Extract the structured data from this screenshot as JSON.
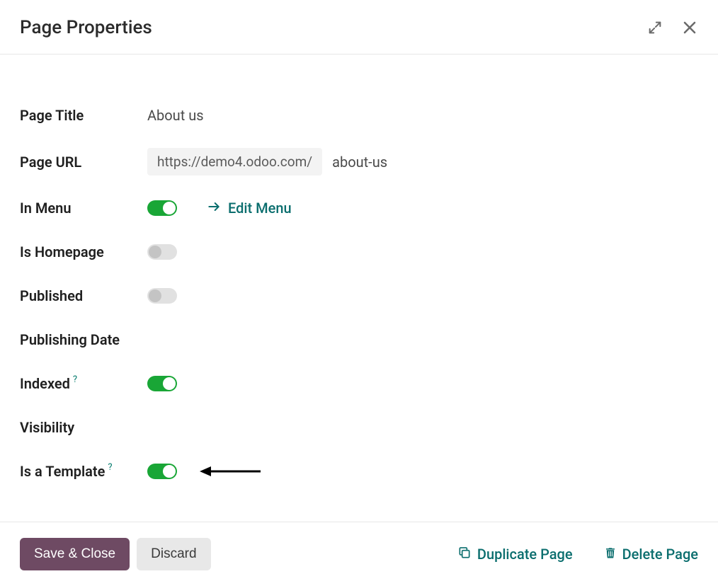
{
  "header": {
    "title": "Page Properties"
  },
  "form": {
    "page_title": {
      "label": "Page Title",
      "value": "About us"
    },
    "page_url": {
      "label": "Page URL",
      "prefix": "https://demo4.odoo.com/",
      "slug": "about-us"
    },
    "in_menu": {
      "label": "In Menu",
      "on": true,
      "edit_label": "Edit Menu"
    },
    "is_homepage": {
      "label": "Is Homepage",
      "on": false
    },
    "published": {
      "label": "Published",
      "on": false
    },
    "publishing_date": {
      "label": "Publishing Date",
      "value": ""
    },
    "indexed": {
      "label": "Indexed",
      "on": true,
      "help": "?"
    },
    "visibility": {
      "label": "Visibility",
      "value": ""
    },
    "is_template": {
      "label": "Is a Template",
      "on": true,
      "help": "?"
    }
  },
  "footer": {
    "save": "Save & Close",
    "discard": "Discard",
    "duplicate": "Duplicate Page",
    "delete": "Delete Page"
  }
}
